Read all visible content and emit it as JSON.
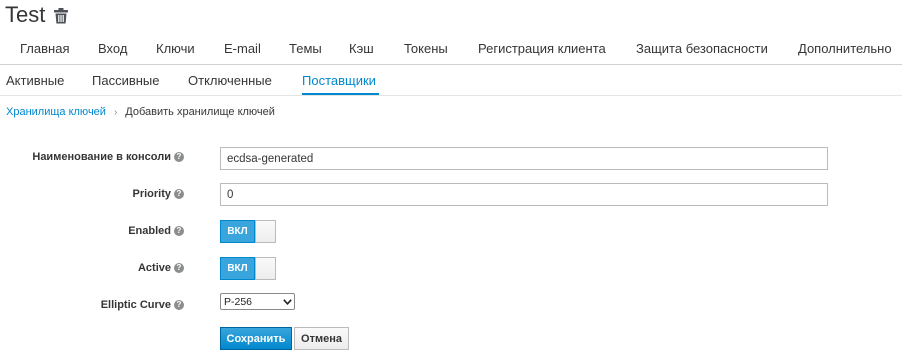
{
  "header": {
    "title": "Test",
    "delete_icon": "trash-icon"
  },
  "main_tabs": [
    {
      "label": "Главная"
    },
    {
      "label": "Вход"
    },
    {
      "label": "Ключи"
    },
    {
      "label": "E-mail"
    },
    {
      "label": "Темы"
    },
    {
      "label": "Кэш"
    },
    {
      "label": "Токены"
    },
    {
      "label": "Регистрация клиента"
    },
    {
      "label": "Защита безопасности"
    },
    {
      "label": "Дополнительно"
    }
  ],
  "sub_tabs": [
    {
      "label": "Активные"
    },
    {
      "label": "Пассивные"
    },
    {
      "label": "Отключенные"
    },
    {
      "label": "Поставщики",
      "active": true
    }
  ],
  "breadcrumb": {
    "parent": "Хранилища ключей",
    "separator": "›",
    "current": "Добавить хранилище ключей"
  },
  "form": {
    "console_name": {
      "label": "Наименование в консоли",
      "value": "ecdsa-generated"
    },
    "priority": {
      "label": "Priority",
      "value": "0"
    },
    "enabled": {
      "label": "Enabled",
      "toggle_text": "ВКЛ",
      "on": true
    },
    "active": {
      "label": "Active",
      "toggle_text": "ВКЛ",
      "on": true
    },
    "elliptic_curve": {
      "label": "Elliptic Curve",
      "selected": "P-256"
    },
    "help_icon_glyph": "?"
  },
  "buttons": {
    "save": "Сохранить",
    "cancel": "Отмена"
  },
  "colors": {
    "accent": "#0088ce",
    "toggle_on": "#39a5dc",
    "text": "#363636"
  }
}
